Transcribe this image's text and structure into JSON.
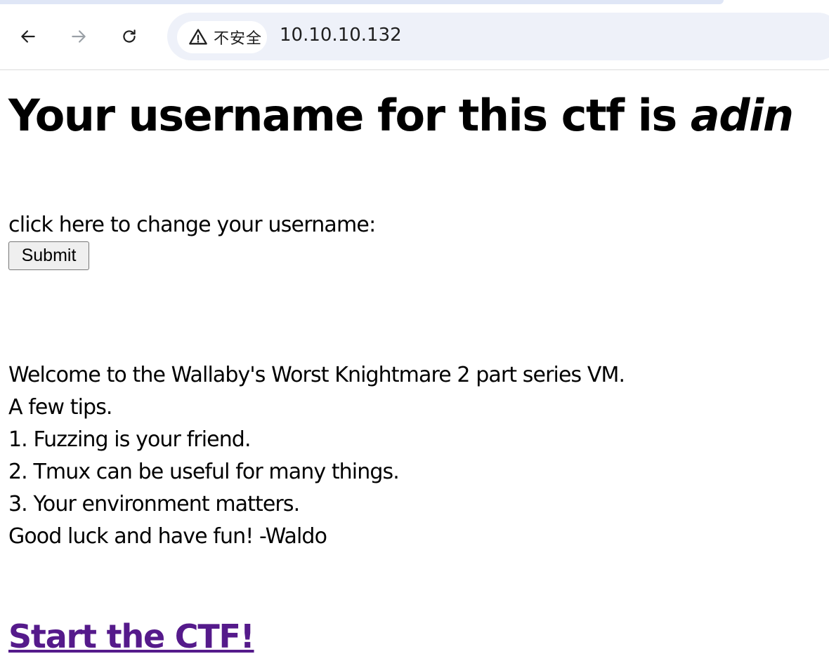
{
  "browser": {
    "security_label": "不安全",
    "url": "10.10.10.132"
  },
  "page": {
    "headline_prefix": "Your username for this ctf is ",
    "username": "adin",
    "change_label": "click here to change your username:",
    "submit_label": "Submit",
    "tips": [
      "Welcome to the Wallaby's Worst Knightmare 2 part series VM.",
      "A few tips.",
      "1. Fuzzing is your friend.",
      "2. Tmux can be useful for many things.",
      "3. Your environment matters.",
      "Good luck and have fun! -Waldo"
    ],
    "start_link": "Start the CTF!"
  },
  "colors": {
    "visited_link": "#551a8b",
    "omnibox_bg": "#eef1f9"
  }
}
